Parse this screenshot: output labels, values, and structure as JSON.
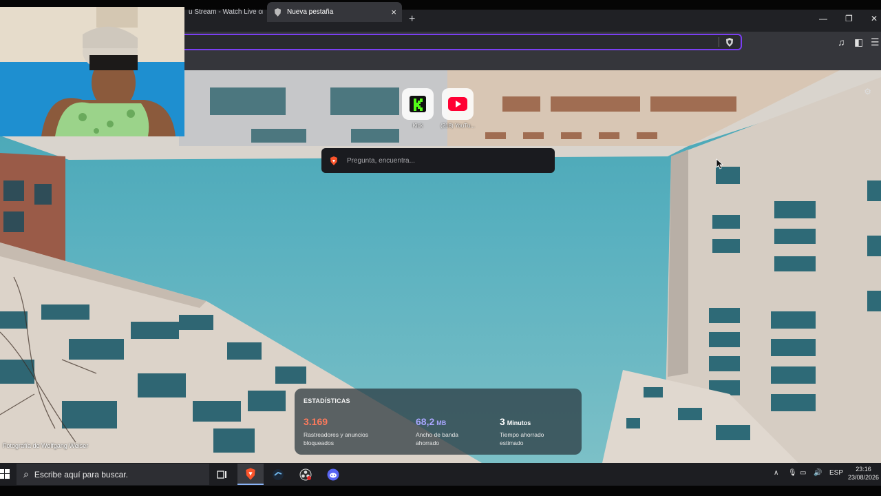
{
  "browser": {
    "tabs": [
      {
        "label": "u Stream - Watch Live on"
      },
      {
        "label": "Nueva pestaña"
      }
    ],
    "new_tab_symbol": "+",
    "close_symbol": "×",
    "window_controls": [
      "—",
      "❐",
      "✕"
    ],
    "address": {
      "value": ""
    }
  },
  "ntp": {
    "tiles": [
      {
        "label": "Kick",
        "icon": "kick-icon",
        "color": "#53fc18"
      },
      {
        "label": "(218) YouTu...",
        "icon": "youtube-icon",
        "color": "#ff0033"
      }
    ],
    "search": {
      "placeholder": "Pregunta, encuentra..."
    },
    "photo_credit": "Fotografía de Wolfgang Weiser",
    "stats": {
      "title": "ESTADÍSTICAS",
      "items": [
        {
          "value": "3.169",
          "unit": "",
          "label": "Rastreadores y anuncios\nbloqueados",
          "color": "#ff7a5c"
        },
        {
          "value": "68,2",
          "unit": "MB",
          "label": "Ancho de banda\nahorrado",
          "color": "#a9a6ff"
        },
        {
          "value": "3",
          "unit": "Minutos",
          "label": "Tiempo ahorrado\nestimado",
          "color": "#ffffff"
        }
      ]
    }
  },
  "taskbar": {
    "search_text": "Escribe aquí para buscar.",
    "tray_language": "ESP",
    "time": "23:16",
    "date": "23/08/2026"
  },
  "colors": {
    "accent": "#7b3ff2",
    "brave": "#fb542b"
  }
}
